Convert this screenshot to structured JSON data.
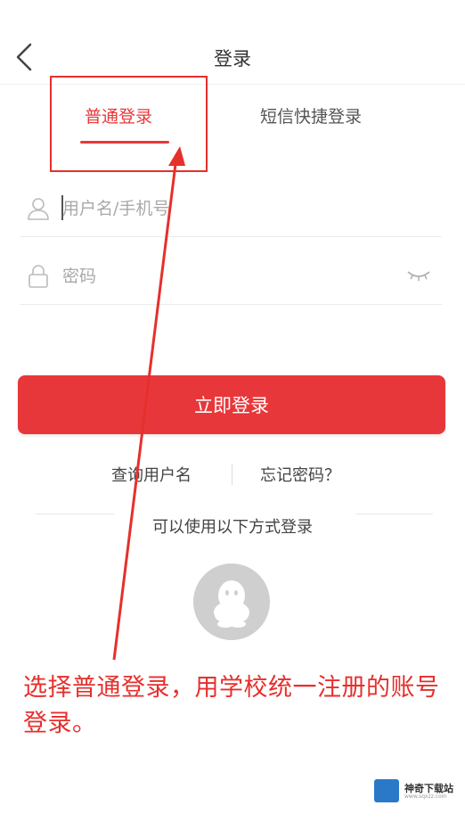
{
  "header": {
    "title": "登录",
    "back_icon": "chevron-left-icon"
  },
  "tabs": [
    {
      "label": "普通登录",
      "active": true
    },
    {
      "label": "短信快捷登录",
      "active": false
    }
  ],
  "form": {
    "username_placeholder": "用户名/手机号",
    "password_placeholder": "密码",
    "user_icon": "user-icon",
    "lock_icon": "lock-icon",
    "eye_icon": "eye-closed-icon"
  },
  "login_button": {
    "label": "立即登录"
  },
  "links": {
    "query_username": "查询用户名",
    "forgot_password": "忘记密码？"
  },
  "alt_login": {
    "text": "可以使用以下方式登录",
    "qq_icon": "qq-icon"
  },
  "annotation": {
    "text": "选择普通登录，用学校统一注册的账号登录。",
    "color": "#e5302c"
  },
  "watermark": {
    "text": "神奇下载站",
    "sub": "www.sqxzz.com"
  },
  "colors": {
    "accent": "#e8373a",
    "background": "#ffffff"
  }
}
